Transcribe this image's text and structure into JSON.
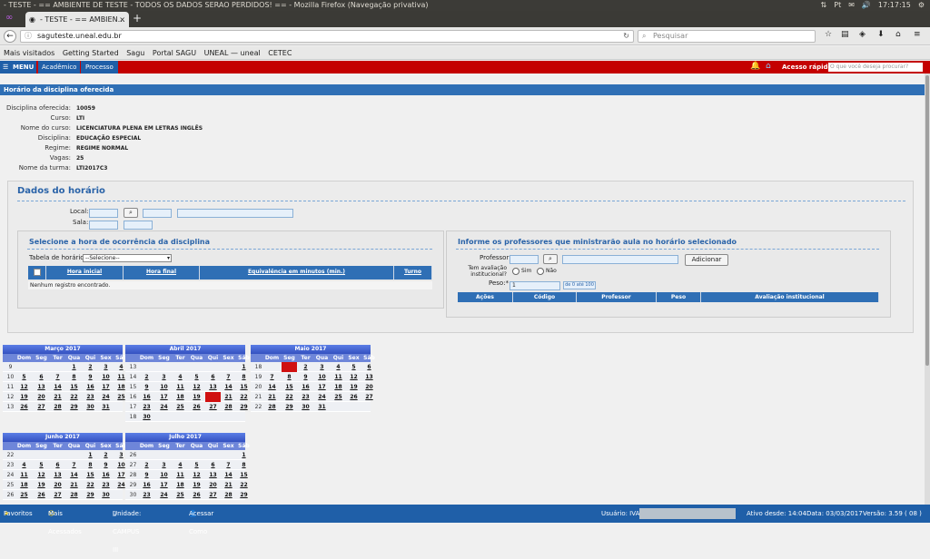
{
  "os": {
    "title": "- TESTE - == AMBIENTE DE TESTE - TODOS OS DADOS SERAO PERDIDOS! == - Mozilla Firefox (Navegação privativa)",
    "clock": "17:17:15"
  },
  "browser": {
    "tab_title": "- TESTE - == AMBIEN…",
    "url": "saguteste.uneal.edu.br",
    "search_placeholder": "Pesquisar",
    "bookmarks": [
      "Mais visitados",
      "Getting Started",
      "Sagu",
      "Portal SAGU",
      "UNEAL — uneal",
      "CETEC"
    ]
  },
  "appbar": {
    "menu": "MENU",
    "academico": "Acadêmico",
    "processo": "Processo",
    "quick_access": "Acesso rápido",
    "quick_placeholder": "O que você deseja procurar?"
  },
  "page": {
    "title": "Horário da disciplina oferecida",
    "fields": [
      {
        "label": "Disciplina oferecida:",
        "value": "10059"
      },
      {
        "label": "Curso:",
        "value": "LTI"
      },
      {
        "label": "Nome do curso:",
        "value": "LICENCIATURA PLENA EM LETRAS INGLÊS"
      },
      {
        "label": "Disciplina:",
        "value": "EDUCAÇÃO ESPECIAL"
      },
      {
        "label": "Regime:",
        "value": "REGIME NORMAL"
      },
      {
        "label": "Vagas:",
        "value": "25"
      },
      {
        "label": "Nome da turma:",
        "value": "LTI2017C3"
      }
    ],
    "dados_title": "Dados do horário",
    "local_label": "Local:",
    "sala_label": "Sala:",
    "hora_title": "Selecione a hora de ocorrência da disciplina",
    "tabela_label": "Tabela de horários:",
    "tabela_selected": "--Selecione--",
    "hora_columns": [
      "Hora inicial",
      "Hora final",
      "Equivalência em minutos (min.)",
      "Turno"
    ],
    "hora_empty": "Nenhum registro encontrado.",
    "prof_title": "Informe os professores que ministrarão aula no horário selecionado",
    "professor_label": "Professor:",
    "adicionar": "Adicionar",
    "tem_avaliacao_label": "Tem avaliação institucional?",
    "sim": "Sim",
    "nao": "Não",
    "peso_label": "Peso:*",
    "peso_value": "1",
    "peso_hint": "de 0 até 100",
    "prof_columns": [
      "Ações",
      "Código",
      "Professor",
      "Peso",
      "Avaliação institucional"
    ]
  },
  "calendars": [
    {
      "title": "Março 2017",
      "weeks": [
        [
          "9",
          "",
          "",
          "",
          "1",
          "2",
          "3",
          "4"
        ],
        [
          "10",
          "5",
          "6",
          "7",
          "8",
          "9",
          "10",
          "11"
        ],
        [
          "11",
          "12",
          "13",
          "14",
          "15",
          "16",
          "17",
          "18"
        ],
        [
          "12",
          "19",
          "20",
          "21",
          "22",
          "23",
          "24",
          "25"
        ],
        [
          "13",
          "26",
          "27",
          "28",
          "29",
          "30",
          "31",
          ""
        ]
      ]
    },
    {
      "title": "Abril 2017",
      "weeks": [
        [
          "13",
          "",
          "",
          "",
          "",
          "",
          "",
          "1"
        ],
        [
          "14",
          "2",
          "3",
          "4",
          "5",
          "6",
          "7",
          "8"
        ],
        [
          "15",
          "9",
          "10",
          "11",
          "12",
          "13",
          "14",
          "15"
        ],
        [
          "16",
          "16",
          "17",
          "18",
          "19",
          "20",
          "21",
          "22"
        ],
        [
          "17",
          "23",
          "24",
          "25",
          "26",
          "27",
          "28",
          "29"
        ],
        [
          "18",
          "30",
          "",
          "",
          "",
          "",
          "",
          ""
        ]
      ]
    },
    {
      "title": "Maio 2017",
      "weeks": [
        [
          "18",
          "",
          "1",
          "2",
          "3",
          "4",
          "5",
          "6"
        ],
        [
          "19",
          "7",
          "8",
          "9",
          "10",
          "11",
          "12",
          "13"
        ],
        [
          "20",
          "14",
          "15",
          "16",
          "17",
          "18",
          "19",
          "20"
        ],
        [
          "21",
          "21",
          "22",
          "23",
          "24",
          "25",
          "26",
          "27"
        ],
        [
          "22",
          "28",
          "29",
          "30",
          "31",
          "",
          "",
          ""
        ]
      ]
    },
    {
      "title": "Junho 2017",
      "weeks": [
        [
          "22",
          "",
          "",
          "",
          "",
          "1",
          "2",
          "3"
        ],
        [
          "23",
          "4",
          "5",
          "6",
          "7",
          "8",
          "9",
          "10"
        ],
        [
          "24",
          "11",
          "12",
          "13",
          "14",
          "15",
          "16",
          "17"
        ],
        [
          "25",
          "18",
          "19",
          "20",
          "21",
          "22",
          "23",
          "24"
        ],
        [
          "26",
          "25",
          "26",
          "27",
          "28",
          "29",
          "30",
          ""
        ]
      ]
    },
    {
      "title": "Julho 2017",
      "weeks": [
        [
          "26",
          "",
          "",
          "",
          "",
          "",
          "",
          "1"
        ],
        [
          "27",
          "2",
          "3",
          "4",
          "5",
          "6",
          "7",
          "8"
        ],
        [
          "28",
          "9",
          "10",
          "11",
          "12",
          "13",
          "14",
          "15"
        ],
        [
          "29",
          "16",
          "17",
          "18",
          "19",
          "20",
          "21",
          "22"
        ],
        [
          "30",
          "23",
          "24",
          "25",
          "26",
          "27",
          "28",
          "29"
        ]
      ]
    }
  ],
  "calendar_dow": [
    "Dom",
    "Seg",
    "Ter",
    "Qua",
    "Qui",
    "Sex",
    "Sáb"
  ],
  "statusbar": {
    "favoritos": "Favoritos",
    "mais_acessados": "Mais Acessados",
    "unidade": "Unidade: CAMPUS III",
    "acessar_como": "Acessar Como",
    "usuario": "Usuário: IVAN",
    "ativo": "Ativo desde: 14:04",
    "data": "Data: 03/03/2017",
    "versao": "Versão: 3.59 ( 08 )"
  }
}
